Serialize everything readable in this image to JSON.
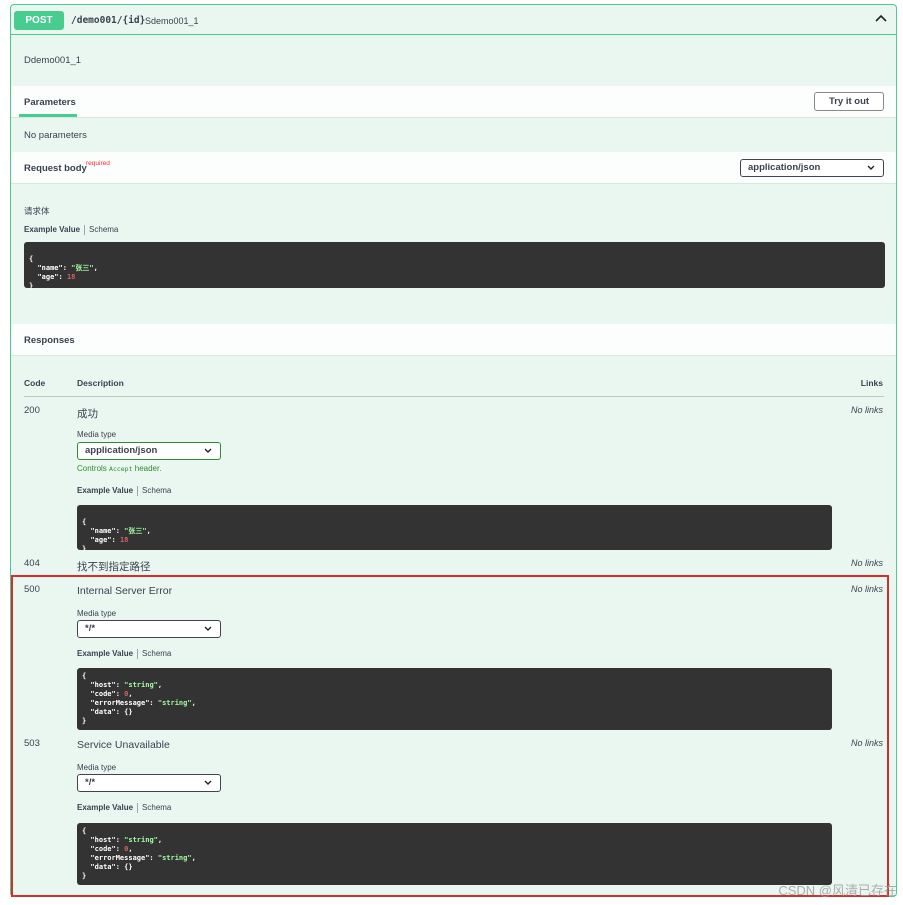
{
  "operation": {
    "method": "POST",
    "path": "/demo001/{id}",
    "summary": "Sdemo001_1",
    "description": "Ddemo001_1",
    "collapse_icon": "chevron-up-icon"
  },
  "parameters": {
    "tab_label": "Parameters",
    "try_button": "Try it out",
    "empty_text": "No parameters"
  },
  "request_body": {
    "label": "Request body",
    "required": "required",
    "content_type": "application/json",
    "description": "请求体",
    "example_tab": "Example Value",
    "schema_tab": "Schema",
    "example": [
      {
        "text": "{"
      },
      {
        "key": "\"name\"",
        "value": "\"张三\"",
        "type": "str",
        "trail": ","
      },
      {
        "key": "\"age\"",
        "value": "18",
        "type": "num",
        "trail": ""
      },
      {
        "text": "}"
      }
    ]
  },
  "responses": {
    "title": "Responses",
    "col_code": "Code",
    "col_description": "Description",
    "col_links": "Links",
    "items": [
      {
        "code": "200",
        "description": "成功",
        "links": "No links",
        "media_type_label": "Media type",
        "media_type": "application/json",
        "controls_prefix": "Controls",
        "controls_mono": "Accept",
        "controls_suffix": "header.",
        "example_tab": "Example Value",
        "schema_tab": "Schema"
      },
      {
        "code": "404",
        "description": "找不到指定路径",
        "links": "No links"
      },
      {
        "code": "500",
        "description": "Internal Server Error",
        "links": "No links",
        "media_type_label": "Media type",
        "media_type": "*/*",
        "example_tab": "Example Value",
        "schema_tab": "Schema"
      },
      {
        "code": "503",
        "description": "Service Unavailable",
        "links": "No links",
        "media_type_label": "Media type",
        "media_type": "*/*",
        "example_tab": "Example Value",
        "schema_tab": "Schema"
      }
    ]
  },
  "watermark": "CSDN @风清已存在",
  "colors": {
    "post_green": "#49cc90",
    "panel_bg": "#eaf7f0",
    "code_bg": "#333333",
    "highlight_red": "#d32f2f"
  }
}
